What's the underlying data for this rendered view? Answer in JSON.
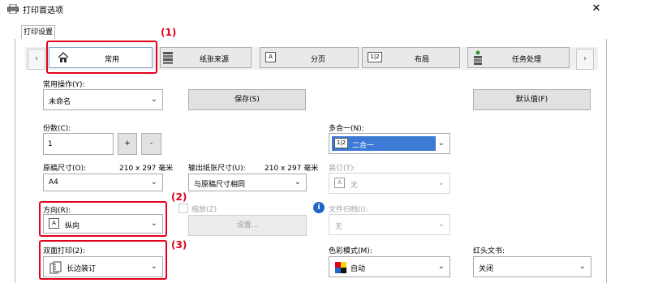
{
  "window": {
    "title": "打印首选项",
    "close_glyph": "✕"
  },
  "tab": {
    "label": "打印设置"
  },
  "sheet_nav": {
    "prev_glyph": "‹",
    "next_glyph": "›",
    "items": [
      {
        "label": "常用",
        "icon": "home-icon",
        "active": true
      },
      {
        "label": "纸张来源",
        "icon": "printer-tray-icon",
        "active": false
      },
      {
        "label": "分页",
        "icon": "page-a-icon",
        "active": false
      },
      {
        "label": "布局",
        "icon": "layout-1-2-icon",
        "active": false
      },
      {
        "label": "任务处理",
        "icon": "job-stack-icon",
        "active": false
      }
    ]
  },
  "callouts": {
    "c1": "(1)",
    "c2": "(2)",
    "c3": "(3)"
  },
  "favorites": {
    "label": "常用操作(Y):",
    "value": "未命名",
    "save_label": "保存(S)",
    "default_label": "默认值(F)"
  },
  "copies": {
    "label": "份数(C):",
    "value": "1",
    "plus": "+",
    "minus": "-"
  },
  "original_size": {
    "label": "原稿尺寸(O):",
    "dims": "210 x 297 毫米",
    "value": "A4"
  },
  "output_size": {
    "label": "输出纸张尺寸(U):",
    "dims": "210 x 297 毫米",
    "value": "与原稿尺寸相同"
  },
  "orientation": {
    "label": "方向(R):",
    "value": "纵向",
    "icon": "A"
  },
  "zoom": {
    "label": "缩放(Z)",
    "settings_label": "设置..."
  },
  "duplex": {
    "label": "双面打印(2):",
    "value": "长边装订"
  },
  "nup": {
    "label": "多合一(N):",
    "value": "二合一",
    "icon": "1|2"
  },
  "binding": {
    "label": "装订(T):",
    "value": "无",
    "icon": "A"
  },
  "file_retention": {
    "label": "文件归档(I):",
    "value": "无",
    "info_glyph": "i"
  },
  "color_mode": {
    "label": "色彩模式(M):",
    "value": "自动"
  },
  "banner": {
    "label": "红头文书:",
    "value": "关闭"
  },
  "colors": {
    "accent": "#e3001b",
    "selection": "#3d7ad5",
    "info": "#1f66c5"
  }
}
